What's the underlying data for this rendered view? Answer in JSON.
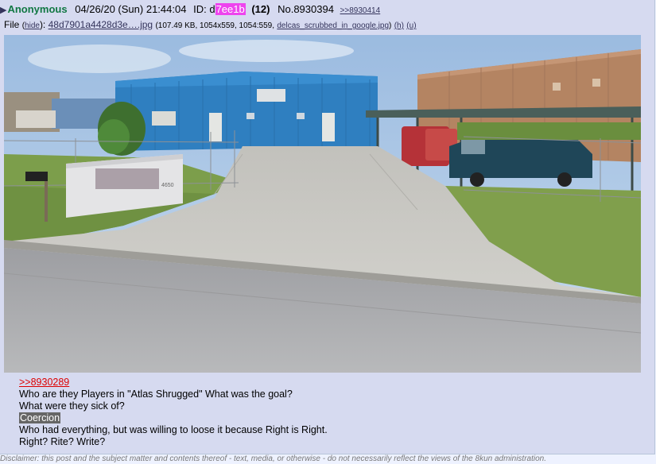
{
  "post": {
    "arrow": "▶",
    "name": "Anonymous",
    "datetime": "04/26/20 (Sun) 21:44:04",
    "id_label": "ID:",
    "id_prefix": "d",
    "id_highlight": "7ee1b",
    "post_count": "(12)",
    "post_no": "No.8930394",
    "backlink": ">>8930414"
  },
  "file": {
    "label": "File",
    "hide_open": "(",
    "hide": "hide",
    "hide_close": "):",
    "filename": "48d7901a4428d3e….jpg",
    "meta_open": "(107.49 KB, 1054x559, 1054:559,",
    "original_name": "delcas_scrubbed_in_google.jpg",
    "meta_close": ")",
    "h_link": "(h)",
    "u_link": "(u)"
  },
  "image": {
    "sign_text": "4650",
    "colors": {
      "sky": "#a9c7e6",
      "building_blue": "#2f7fc0",
      "brick_wall": "#b48462",
      "grass": "#7c9e4b",
      "concrete": "#c8c6c0",
      "road": "#a9a9ab"
    }
  },
  "message": {
    "quote_link": ">>8930289",
    "line1": "Who are they Players in \"Atlas Shrugged\" What was the goal?",
    "line2": "What were they sick of?",
    "spoiler": "Coercion",
    "line4": "Who had everything, but was willing to loose it because Right is Right.",
    "line5": "Right? Rite? Write?"
  },
  "disclaimer": "Disclaimer: this post and the subject matter and contents thereof - text, media, or otherwise - do not necessarily reflect the views of the 8kun administration."
}
